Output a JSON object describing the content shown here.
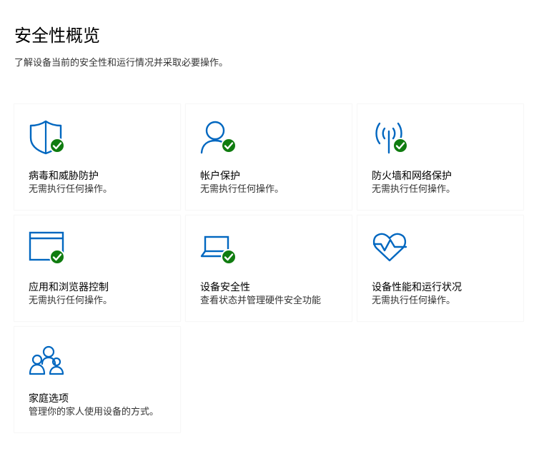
{
  "header": {
    "title": "安全性概览",
    "description": "了解设备当前的安全性和运行情况并采取必要操作。"
  },
  "colors": {
    "accent": "#0067c0",
    "ok_badge": "#107c10"
  },
  "tiles": [
    {
      "title": "病毒和威胁防护",
      "status": "无需执行任何操作。",
      "icon": "shield-icon",
      "badge": "check-badge-icon"
    },
    {
      "title": "帐户保护",
      "status": "无需执行任何操作。",
      "icon": "person-icon",
      "badge": "check-badge-icon"
    },
    {
      "title": "防火墙和网络保护",
      "status": "无需执行任何操作。",
      "icon": "antenna-icon",
      "badge": "check-badge-icon"
    },
    {
      "title": "应用和浏览器控制",
      "status": "无需执行任何操作。",
      "icon": "browser-window-icon",
      "badge": "check-badge-icon"
    },
    {
      "title": "设备安全性",
      "status": "查看状态并管理硬件安全功能",
      "icon": "laptop-icon",
      "badge": "check-badge-icon"
    },
    {
      "title": "设备性能和运行状况",
      "status": "无需执行任何操作。",
      "icon": "heart-pulse-icon",
      "badge": ""
    },
    {
      "title": "家庭选项",
      "status": "管理你的家人使用设备的方式。",
      "icon": "family-icon",
      "badge": ""
    }
  ]
}
